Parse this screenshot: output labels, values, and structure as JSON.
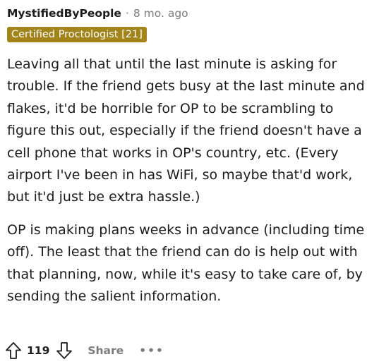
{
  "comment": {
    "username": "MystifiedByPeople",
    "separator": "·",
    "timestamp": "8 mo. ago",
    "flair": "Certified Proctologist [21]",
    "flair_color": "#a3841b",
    "paragraphs": [
      "Leaving all that until the last minute is asking for trouble. If the friend gets busy at the last minute and flakes, it'd be horrible for OP to be scrambling to figure this out, especially if the friend doesn't have a cell phone that works in OP's country, etc. (Every airport I've been in has WiFi, so maybe that'd work, but it'd just be extra hassle.)",
      "OP is making plans weeks in advance (including time off). The least that the friend can do is help out with that planning, now, while it's easy to take care of, by sending the salient information."
    ]
  },
  "actions": {
    "upvote_icon": "arrow-up-outline",
    "score": "119",
    "downvote_icon": "arrow-down-outline",
    "share_label": "Share",
    "more_label": "•••"
  }
}
